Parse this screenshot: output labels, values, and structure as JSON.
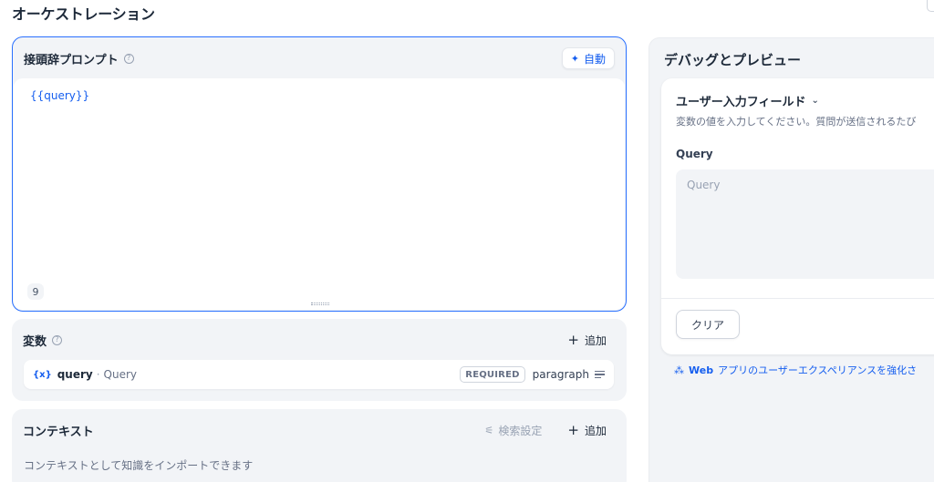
{
  "header": {
    "title": "オーケストレーション"
  },
  "prompt": {
    "title": "接頭辞プロンプト",
    "help_icon": "question-circle-icon",
    "auto_label": "自動",
    "auto_icon": "sparkle-icon",
    "text": "{{query}}",
    "char_count": "9"
  },
  "variables": {
    "title": "変数",
    "help_icon": "question-circle-icon",
    "add_label": "追加",
    "items": [
      {
        "icon_text": "{x}",
        "key": "query",
        "separator": "·",
        "name": "Query",
        "required": "REQUIRED",
        "type": "paragraph"
      }
    ]
  },
  "context": {
    "title": "コンテキスト",
    "retrieval_label": "検索設定",
    "add_label": "追加",
    "description": "コンテキストとして知識をインポートできます"
  },
  "debug": {
    "title": "デバッグとプレビュー",
    "user_input": {
      "title": "ユーザー入力フィールド",
      "description": "変数の値を入力してください。質問が送信されるたび",
      "field_label": "Query",
      "field_placeholder": "Query",
      "clear_label": "クリア"
    },
    "enhance_link": {
      "web": "Web",
      "rest": "アプリのユーザーエクスペリアンスを強化さ"
    }
  },
  "colors": {
    "accent": "#155eef",
    "border_focus": "#2970ff",
    "card_bg": "#f2f4f7"
  }
}
